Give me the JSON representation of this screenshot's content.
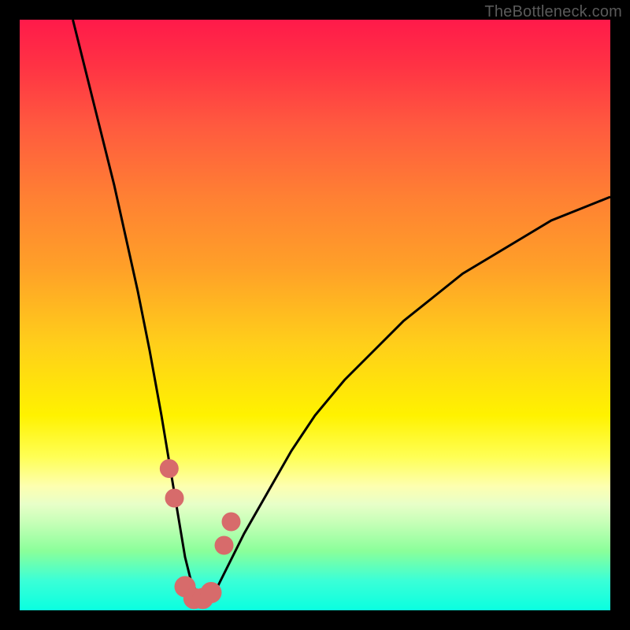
{
  "watermark": "TheBottleneck.com",
  "chart_data": {
    "type": "line",
    "title": "",
    "xlabel": "",
    "ylabel": "",
    "xlim": [
      0,
      100
    ],
    "ylim": [
      0,
      100
    ],
    "grid": false,
    "series": [
      {
        "name": "curve",
        "x": [
          9,
          10,
          12,
          14,
          16,
          18,
          20,
          22,
          24,
          25,
          26,
          27,
          28,
          29,
          30,
          31,
          32,
          33,
          35,
          38,
          42,
          46,
          50,
          55,
          60,
          65,
          70,
          75,
          80,
          85,
          90,
          95,
          100
        ],
        "values": [
          100,
          96,
          88,
          80,
          72,
          63,
          54,
          44,
          33,
          27,
          21,
          15,
          9,
          5,
          3,
          2,
          2,
          3,
          7,
          13,
          20,
          27,
          33,
          39,
          44,
          49,
          53,
          57,
          60,
          63,
          66,
          68,
          70
        ]
      }
    ],
    "markers": [
      {
        "name": "left-upper",
        "x": 25.3,
        "y": 24,
        "r": 1.6
      },
      {
        "name": "left-lower",
        "x": 26.2,
        "y": 19,
        "r": 1.6
      },
      {
        "name": "bottom-1",
        "x": 28.0,
        "y": 4,
        "r": 1.8
      },
      {
        "name": "bottom-2",
        "x": 29.5,
        "y": 2,
        "r": 1.8
      },
      {
        "name": "bottom-3",
        "x": 31.0,
        "y": 2,
        "r": 1.8
      },
      {
        "name": "bottom-4",
        "x": 32.4,
        "y": 3,
        "r": 1.8
      },
      {
        "name": "right-lower",
        "x": 34.6,
        "y": 11,
        "r": 1.6
      },
      {
        "name": "right-upper",
        "x": 35.8,
        "y": 15,
        "r": 1.6
      }
    ],
    "colors": {
      "curve": "#000000",
      "marker": "#d76b6b",
      "gradient_top": "#ff1a4a",
      "gradient_bottom": "#0affe0"
    }
  }
}
